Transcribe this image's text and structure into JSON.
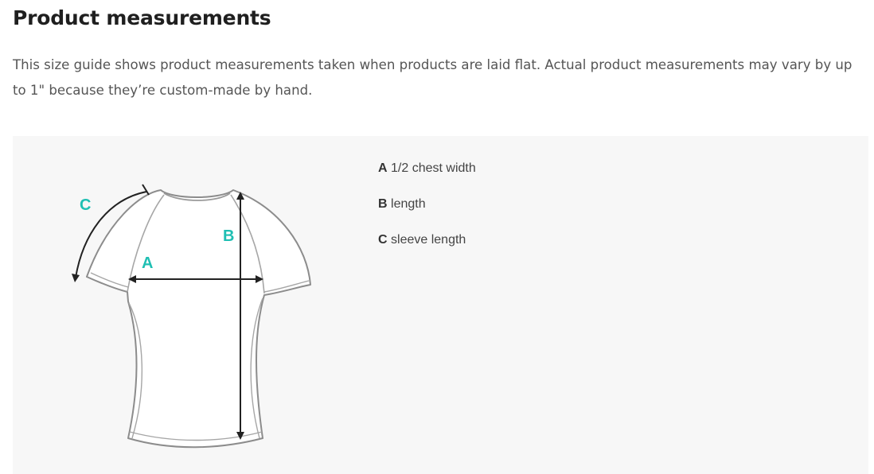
{
  "page": {
    "title": "Product measurements",
    "description": "This size guide shows product measurements taken when products are laid flat. Actual product measurements may vary by up to 1\" because they’re custom-made by hand."
  },
  "diagram": {
    "image": "t-shirt-outline",
    "letters": {
      "a": "A",
      "b": "B",
      "c": "C"
    },
    "letter_color": "#1fbfb3"
  },
  "legend": [
    {
      "key": "A",
      "label": "1/2 chest width"
    },
    {
      "key": "B",
      "label": "length"
    },
    {
      "key": "C",
      "label": "sleeve length"
    }
  ]
}
